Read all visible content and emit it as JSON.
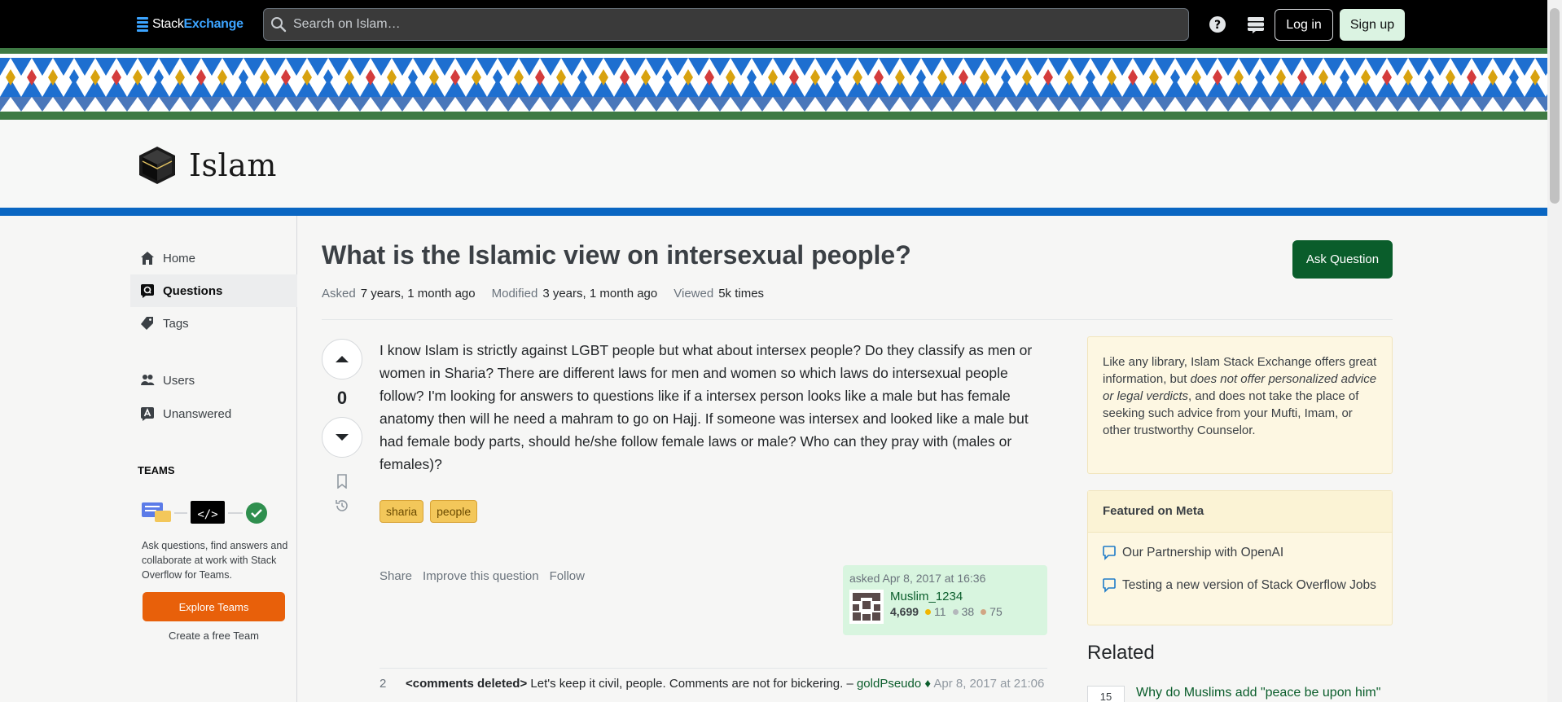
{
  "topbar": {
    "brand_part1": "Stack",
    "brand_part2": "Exchange",
    "search_placeholder": "Search on Islam…",
    "login_label": "Log in",
    "signup_label": "Sign up"
  },
  "site": {
    "name": "Islam"
  },
  "nav": {
    "items": [
      {
        "label": "Home",
        "icon": "home-icon"
      },
      {
        "label": "Questions",
        "icon": "questions-icon",
        "active": true
      },
      {
        "label": "Tags",
        "icon": "tag-icon"
      },
      {
        "label": "Users",
        "icon": "users-icon"
      },
      {
        "label": "Unanswered",
        "icon": "unanswered-icon"
      }
    ],
    "teams_heading": "TEAMS",
    "teams_text": "Ask questions, find answers and collaborate at work with Stack Overflow for Teams.",
    "explore_label": "Explore Teams",
    "create_label": "Create a free Team"
  },
  "question": {
    "title": "What is the Islamic view on intersexual people?",
    "ask_button": "Ask Question",
    "asked_label": "Asked",
    "asked_value": "7 years, 1 month ago",
    "modified_label": "Modified",
    "modified_value": "3 years, 1 month ago",
    "viewed_label": "Viewed",
    "viewed_value": "5k times",
    "votes": "0",
    "body": "I know Islam is strictly against LGBT people but what about intersex people? Do they classify as men or women in Sharia? There are different laws for men and women so which laws do intersexual people follow? I'm looking for answers to questions like if a intersex person looks like a male but has female anatomy then will he need a mahram to go on Hajj. If someone was intersex and looked like a male but had female body parts, should he/she follow female laws or male? Who can they pray with (males or females)?",
    "tags": [
      "sharia",
      "people"
    ],
    "menu": {
      "share": "Share",
      "improve": "Improve this question",
      "follow": "Follow"
    },
    "owner": {
      "time": "asked Apr 8, 2017 at 16:36",
      "name": "Muslim_1234",
      "rep": "4,699",
      "gold": "11",
      "silver": "38",
      "bronze": "75"
    }
  },
  "comment": {
    "score": "2",
    "deleted_tag": "<comments deleted>",
    "text": "Let's keep it civil, people. Comments are not for bickering. –",
    "user": "goldPseudo",
    "mod_mark": "♦",
    "when": "Apr 8, 2017 at 21:06"
  },
  "sidebar": {
    "notice_pre": "Like any library, Islam Stack Exchange offers great information, but ",
    "notice_em": "does not offer personalized advice or legal verdicts",
    "notice_post": ", and does not take the place of seeking such advice from your Mufti, Imam, or other trustworthy Counselor.",
    "featured_heading": "Featured on Meta",
    "featured_items": [
      "Our Partnership with OpenAI",
      "Testing a new version of Stack Overflow Jobs"
    ],
    "related_heading": "Related",
    "related_items": [
      {
        "score": "15",
        "title": "Why do Muslims add \"peace be upon him\""
      }
    ]
  },
  "colors": {
    "accent_green": "#0a5d2b",
    "blue_band": "#0a66c2",
    "orange": "#e8600a",
    "tag_bg": "#f3c75a"
  }
}
